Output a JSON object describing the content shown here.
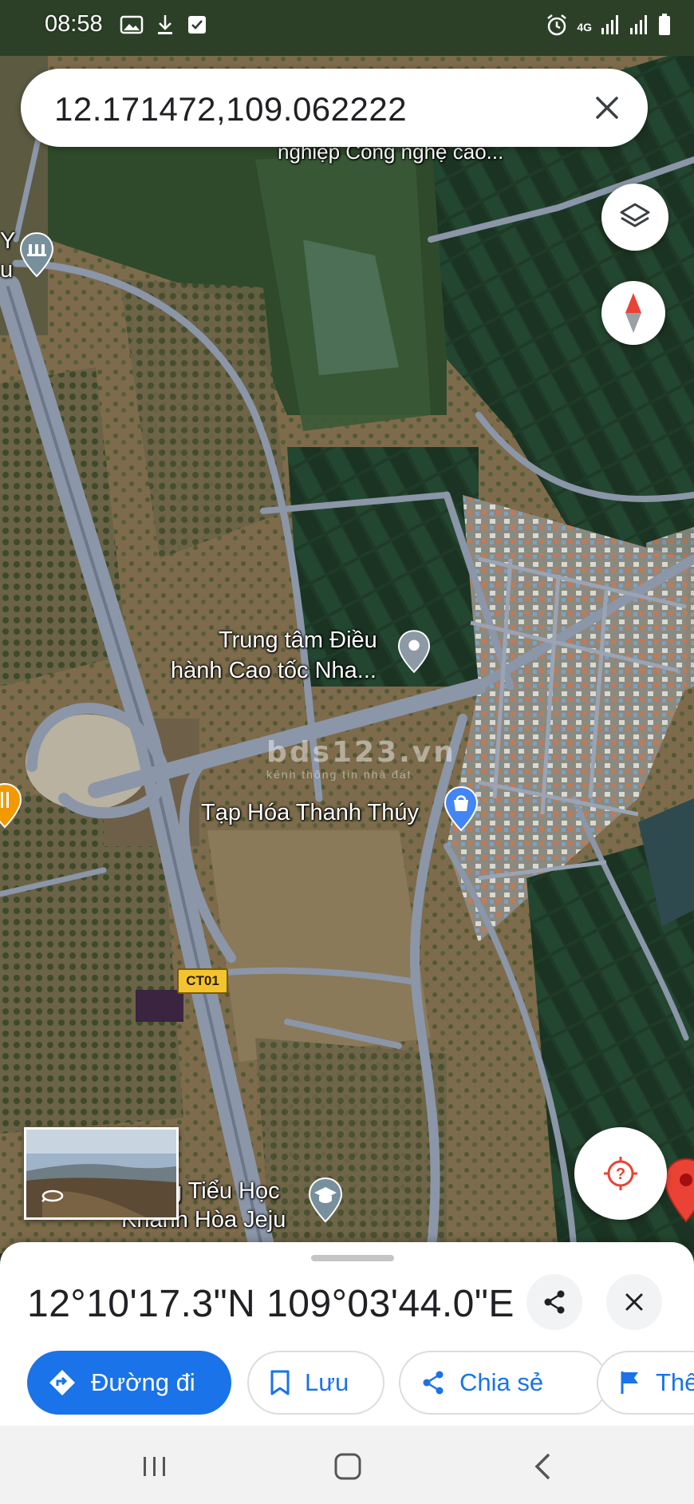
{
  "status_bar": {
    "time": "08:58",
    "network": "4G",
    "left_icons": [
      "gallery-icon",
      "download-icon",
      "check-box-icon"
    ],
    "right_icons": [
      "alarm-icon",
      "signal-icon",
      "signal-icon",
      "battery-icon"
    ]
  },
  "search": {
    "query": "12.171472,109.062222"
  },
  "map": {
    "labels": {
      "top_partial": "nghiệp Công nghệ cao...",
      "left_partial_1": "Y",
      "left_partial_2": "u",
      "poi_1_line1": "Trung tâm Điều",
      "poi_1_line2": "hành Cao tốc Nha...",
      "poi_2": "Tạp Hóa Thanh Thúy",
      "poi_3_line1": "g Tiểu Học",
      "poi_3_line2": "Khánh Hòa Jeju",
      "road_shield": "CT01"
    },
    "watermark": {
      "main": "bds123.vn",
      "sub": "kênh thông tin nhà đất"
    },
    "colors": {
      "marker_red": "#ea4335",
      "poi_grey": "#78909c",
      "shopping_blue": "#4285f4",
      "food_orange": "#f29900"
    }
  },
  "sheet": {
    "coordinates": "12°10'17.3\"N 109°03'44.0\"E",
    "actions": {
      "directions": "Đường đi",
      "save": "Lưu",
      "share": "Chia sẻ",
      "label": "Thê"
    }
  },
  "theme": {
    "accent": "#1a73e8",
    "text": "#202124"
  }
}
